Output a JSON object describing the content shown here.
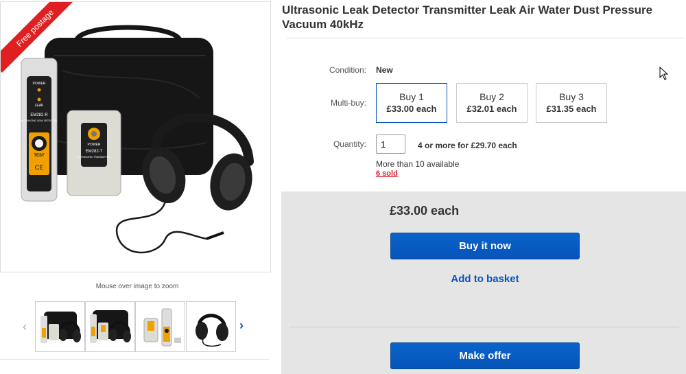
{
  "listing": {
    "ribbon": "Free postage",
    "zoom_hint": "Mouse over image to zoom",
    "device_text": {
      "receiver_model": "EM282-R",
      "receiver_sub": "ULTRASONIC LEAK DETECTOR",
      "receiver_power": "POWER",
      "receiver_leak": "LEAK",
      "receiver_test": "TEST",
      "receiver_ce": "CE",
      "transmitter_power": "POWER",
      "transmitter_model": "EM282-T",
      "transmitter_sub": "ULTRASONIC TRANSMITTER"
    },
    "thumbnails": [
      "thumb-case-kit",
      "thumb-case-kit-2",
      "thumb-units",
      "thumb-headphones"
    ],
    "icons": {
      "prev": "‹",
      "next": "›"
    }
  },
  "product": {
    "title": "Ultrasonic Leak Detector Transmitter Leak Air Water Dust Pressure Vacuum 40kHz",
    "condition_label": "Condition:",
    "condition_value": "New",
    "multibuy_label": "Multi-buy:",
    "tiers": [
      {
        "label": "Buy 1",
        "price": "£33.00 each",
        "selected": true
      },
      {
        "label": "Buy 2",
        "price": "£32.01 each",
        "selected": false
      },
      {
        "label": "Buy 3",
        "price": "£31.35 each",
        "selected": false
      }
    ],
    "quantity_label": "Quantity:",
    "quantity_value": "1",
    "quantity_offer": "4 or more for £29.70 each",
    "availability": "More than 10 available",
    "sold": "6 sold"
  },
  "purchase": {
    "price": "£33.00 each",
    "buy_now": "Buy it now",
    "add_to_basket": "Add to basket",
    "make_offer": "Make offer"
  },
  "colors": {
    "accent": "#0654ba",
    "ribbon": "#e02020",
    "sold": "#dd1e31",
    "panel": "#e5e5e5"
  }
}
